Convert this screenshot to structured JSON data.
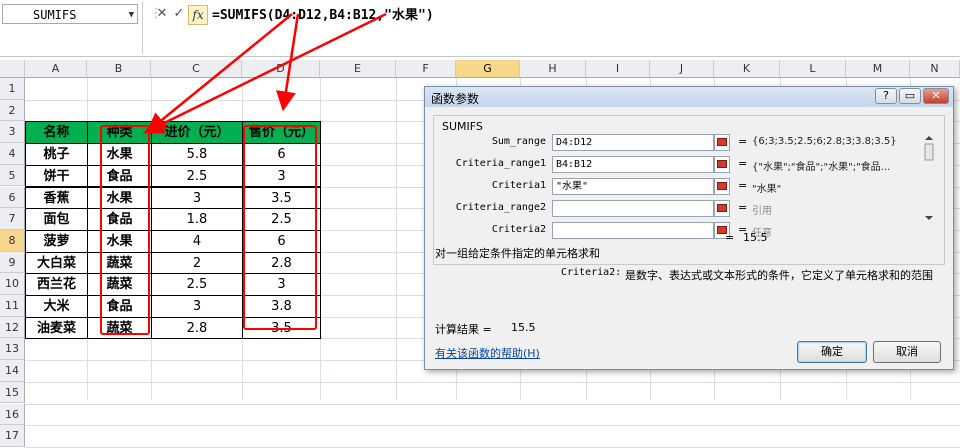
{
  "formula_bar": {
    "name_box": "SUMIFS",
    "cancel_glyph": "✕",
    "enter_glyph": "✓",
    "fx_label": "fx",
    "formula": "=SUMIFS(D4:D12,B4:B12,\"水果\")"
  },
  "columns": [
    "A",
    "B",
    "C",
    "D",
    "E",
    "F",
    "G",
    "H",
    "I",
    "J",
    "K",
    "L",
    "M",
    "N"
  ],
  "rows": [
    "1",
    "2",
    "3",
    "4",
    "5",
    "6",
    "7",
    "8",
    "9",
    "10",
    "11",
    "12",
    "13",
    "14",
    "15",
    "16",
    "17"
  ],
  "table": {
    "headers": [
      "名称",
      "种类",
      "进价（元）",
      "售价（元）"
    ],
    "rows": [
      [
        "桃子",
        "水果",
        "5.8",
        "6"
      ],
      [
        "饼干",
        "食品",
        "2.5",
        "3"
      ],
      [
        "香蕉",
        "水果",
        "3",
        "3.5"
      ],
      [
        "面包",
        "食品",
        "1.8",
        "2.5"
      ],
      [
        "菠萝",
        "水果",
        "4",
        "6"
      ],
      [
        "大白菜",
        "蔬菜",
        "2",
        "2.8"
      ],
      [
        "西兰花",
        "蔬菜",
        "2.5",
        "3"
      ],
      [
        "大米",
        "食品",
        "3",
        "3.8"
      ],
      [
        "油麦菜",
        "蔬菜",
        "2.8",
        "3.5"
      ]
    ]
  },
  "dialog": {
    "title": "函数参数",
    "help_btn": "?",
    "min_btn": "▭",
    "close_btn": "✕",
    "function_name": "SUMIFS",
    "params": [
      {
        "label": "Sum_range",
        "value": "D4:D12",
        "eq": "=",
        "result": "{6;3;3.5;2.5;6;2.8;3;3.8;3.5}"
      },
      {
        "label": "Criteria_range1",
        "value": "B4:B12",
        "eq": "=",
        "result": "{\"水果\";\"食品\";\"水果\";\"食品..."
      },
      {
        "label": "Criteria1",
        "value": "\"水果\"",
        "eq": "=",
        "result": "\"水果\""
      },
      {
        "label": "Criteria_range2",
        "value": "",
        "eq": "=",
        "result": "引用"
      },
      {
        "label": "Criteria2",
        "value": "",
        "eq": "=",
        "result": "任意"
      }
    ],
    "total_eq": "=",
    "total_value": "15.5",
    "description": "对一组给定条件指定的单元格求和",
    "param_help_name": "Criteria2:",
    "param_help_text": "是数字、表达式或文本形式的条件，它定义了单元格求和的范围",
    "calc_label": "计算结果 =",
    "calc_value": "15.5",
    "help_link": "有关该函数的帮助(H)",
    "ok": "确定",
    "cancel": "取消"
  },
  "colors": {
    "header_green": "#00b050",
    "annotation_red": "#ff0000",
    "selected_header": "#f7d88a"
  }
}
